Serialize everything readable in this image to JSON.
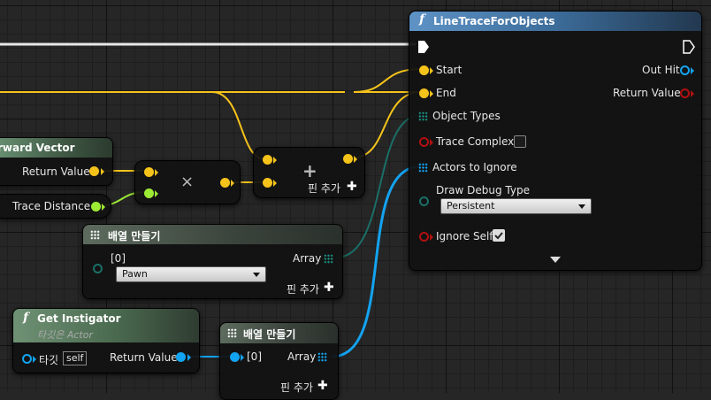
{
  "colors": {
    "exec": "#ffffff",
    "vector": "#f6c31a",
    "float": "#9dea35",
    "object": "#13a3f0",
    "bool": "#b11010",
    "array_objtype": "#1a6f67"
  },
  "forward_vector": {
    "title": "rward Vector",
    "return_label": "Return Value"
  },
  "trace_distance": {
    "label": "Trace Distance"
  },
  "multiply": {
    "symbol": "×"
  },
  "add": {
    "symbol": "+",
    "add_pin": "핀 추가"
  },
  "make_array_1": {
    "title": "배열 만들기",
    "index_label": "[0]",
    "array_label": "Array",
    "selected": "Pawn",
    "add_pin": "핀 추가"
  },
  "get_instigator": {
    "title": "Get Instigator",
    "subtitle": "타깃은 Actor",
    "target_label": "타깃",
    "target_value": "self",
    "return_label": "Return Value"
  },
  "make_array_2": {
    "title": "배열 만들기",
    "index_label": "[0]",
    "array_label": "Array",
    "add_pin": "핀 추가"
  },
  "line_trace": {
    "title": "LineTraceForObjects",
    "start": "Start",
    "end": "End",
    "object_types": "Object Types",
    "trace_complex": "Trace Complex",
    "actors_to_ignore": "Actors to Ignore",
    "draw_debug_type": "Draw Debug Type",
    "draw_debug_value": "Persistent",
    "ignore_self": "Ignore Self",
    "ignore_self_checked": true,
    "out_hit": "Out Hit",
    "return_value": "Return Value"
  }
}
